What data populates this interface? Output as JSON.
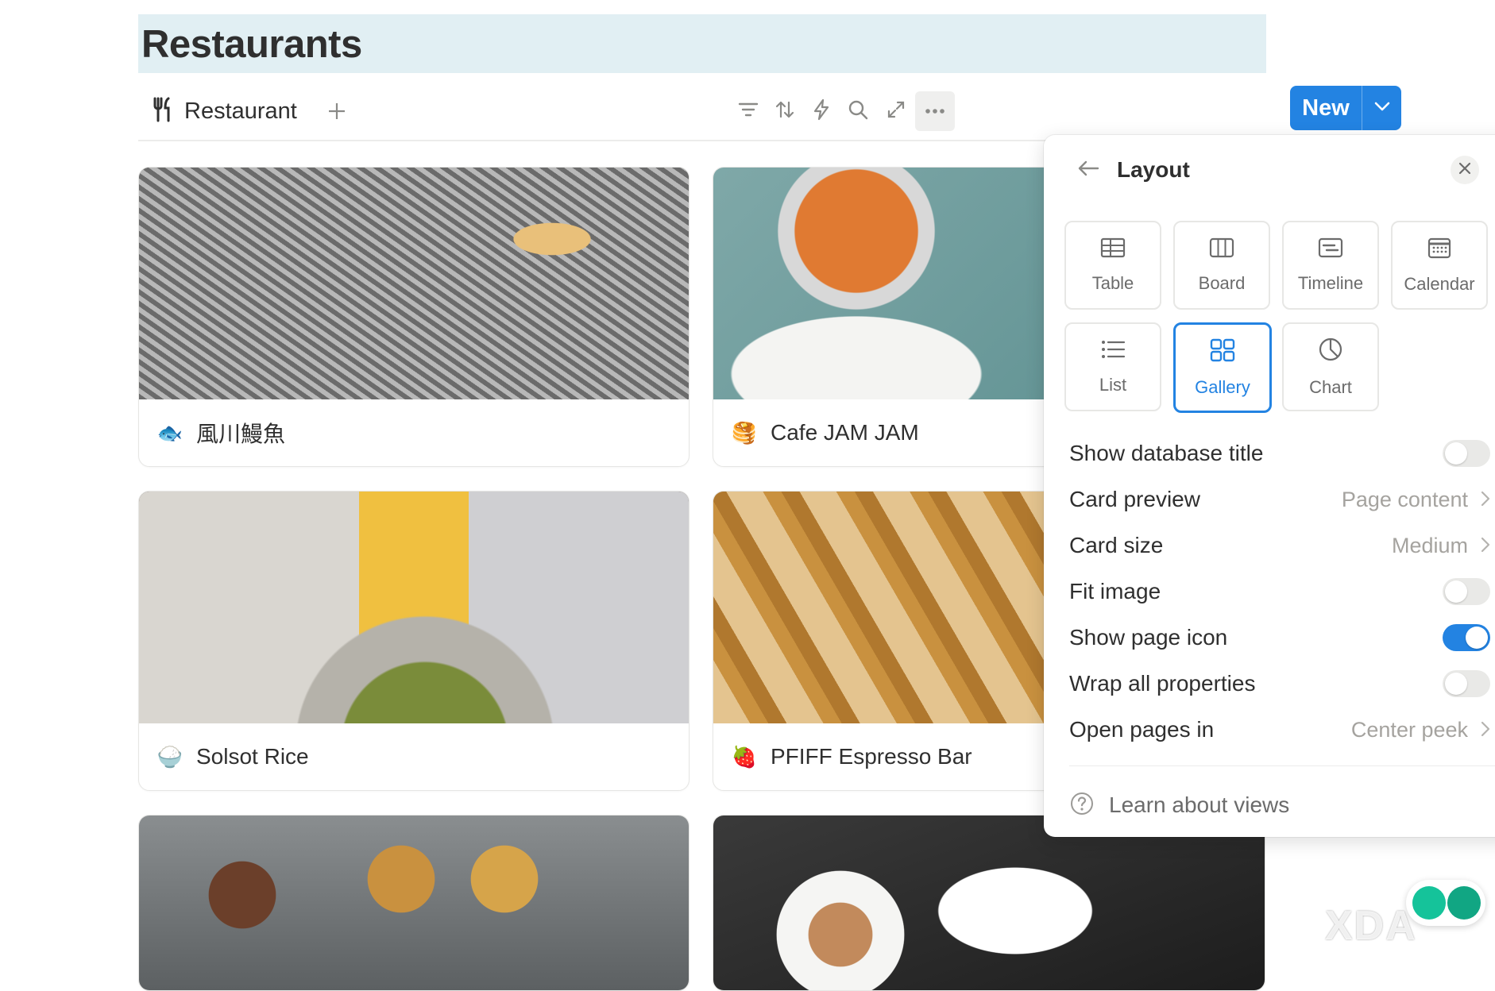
{
  "page": {
    "title": "Restaurants"
  },
  "view_bar": {
    "tab_label": "Restaurant",
    "tab_icon": "fork-knife-icon",
    "toolbar_icons": [
      "filter-icon",
      "sort-icon",
      "automation-icon",
      "search-icon",
      "expand-icon",
      "more-icon"
    ],
    "new_label": "New"
  },
  "cards": [
    {
      "name": "風川鰻魚",
      "icon": "🐟"
    },
    {
      "name": "Cafe JAM JAM",
      "icon": "🥞"
    },
    {
      "name": "Solsot Rice",
      "icon": "🍚"
    },
    {
      "name": "PFIFF Espresso Bar",
      "icon": "🍓"
    },
    {
      "name": "",
      "icon": ""
    },
    {
      "name": "",
      "icon": ""
    }
  ],
  "layout_panel": {
    "title": "Layout",
    "options": [
      {
        "label": "Table",
        "icon": "table-icon"
      },
      {
        "label": "Board",
        "icon": "board-icon"
      },
      {
        "label": "Timeline",
        "icon": "timeline-icon"
      },
      {
        "label": "Calendar",
        "icon": "calendar-icon"
      },
      {
        "label": "List",
        "icon": "list-icon"
      },
      {
        "label": "Gallery",
        "icon": "gallery-icon",
        "selected": true
      },
      {
        "label": "Chart",
        "icon": "chart-icon"
      }
    ],
    "settings": {
      "show_db_title": {
        "label": "Show database title",
        "on": false
      },
      "card_preview": {
        "label": "Card preview",
        "value": "Page content"
      },
      "card_size": {
        "label": "Card size",
        "value": "Medium"
      },
      "fit_image": {
        "label": "Fit image",
        "on": false
      },
      "show_page_icon": {
        "label": "Show page icon",
        "on": true
      },
      "wrap_props": {
        "label": "Wrap all properties",
        "on": false
      },
      "open_pages_in": {
        "label": "Open pages in",
        "value": "Center peek"
      }
    },
    "learn_label": "Learn about views"
  },
  "colors": {
    "accent": "#2383e2",
    "title_bg": "#e1eff3"
  },
  "watermark": "XDA"
}
